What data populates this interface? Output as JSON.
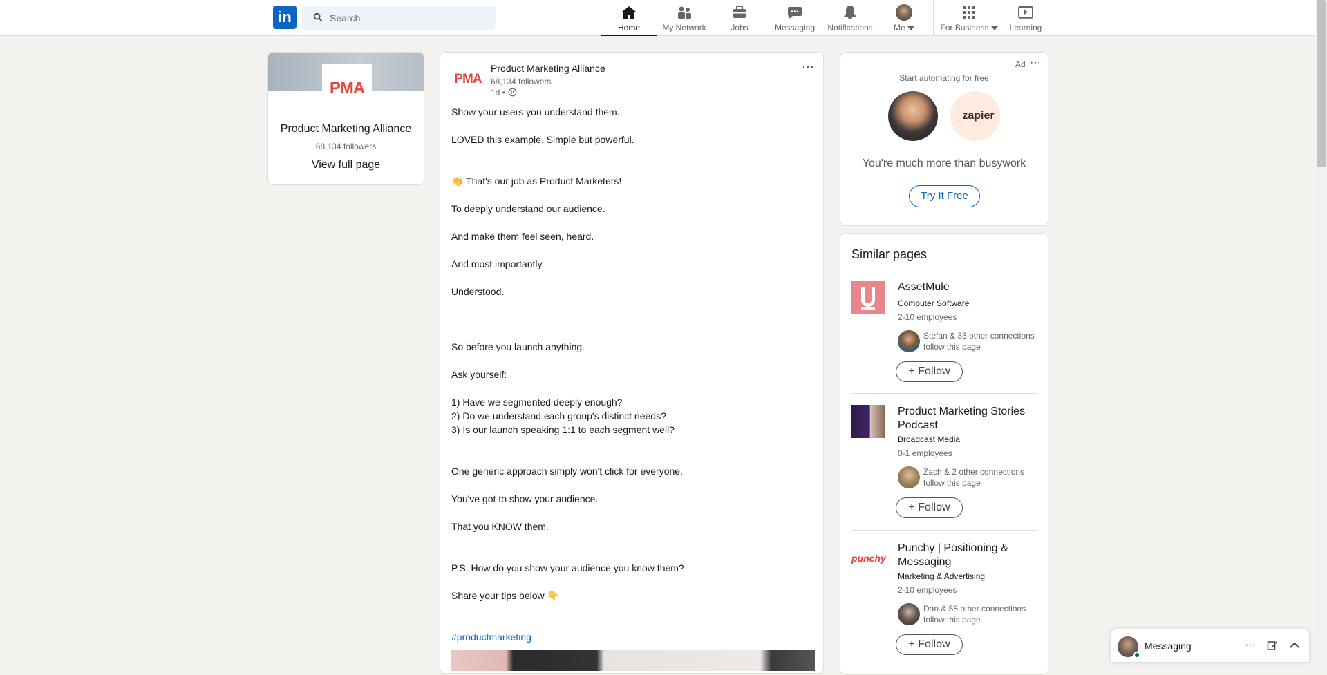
{
  "nav": {
    "search_placeholder": "Search",
    "items": [
      {
        "label": "Home"
      },
      {
        "label": "My Network"
      },
      {
        "label": "Jobs"
      },
      {
        "label": "Messaging"
      },
      {
        "label": "Notifications"
      },
      {
        "label": "Me"
      },
      {
        "label": "For Business"
      },
      {
        "label": "Learning"
      }
    ]
  },
  "company_card": {
    "logo_text": "PMA",
    "name": "Product Marketing Alliance",
    "followers": "68,134 followers",
    "view_link": "View full page"
  },
  "post": {
    "author": "Product Marketing Alliance",
    "followers": "68,134 followers",
    "time": "1d •",
    "more": "···",
    "lines": [
      "Show your users you understand them.",
      "LOVED this example. Simple but powerful.",
      "👏 That's our job as Product Marketers!",
      "To deeply understand our audience.",
      "And make them feel seen, heard.",
      "And most importantly.",
      "Understood.",
      "So before you launch anything.",
      "Ask yourself:",
      "1) Have we segmented deeply enough?",
      "2) Do we understand each group's distinct needs?",
      "3) Is our launch speaking 1:1 to each segment well?",
      "One generic approach simply won't click for everyone.",
      "You've got to show your audience.",
      "That you KNOW them.",
      "P.S. How do you show your audience you know them?",
      "Share your tips below 👇"
    ],
    "hashtag": "#productmarketing"
  },
  "ad": {
    "label": "Ad",
    "more": "···",
    "tagline": "Start automating for free",
    "brand": "zapier",
    "headline": "You're much more than busywork",
    "cta": "Try It Free"
  },
  "similar": {
    "title": "Similar pages",
    "items": [
      {
        "name": "AssetMule",
        "industry": "Computer Software",
        "employees": "2-10 employees",
        "connections": "Stefan & 33 other connections follow this page",
        "follow": "Follow"
      },
      {
        "name": "Product Marketing Stories Podcast",
        "industry": "Broadcast Media",
        "employees": "0-1 employees",
        "connections": "Zach & 2 other connections follow this page",
        "follow": "Follow"
      },
      {
        "name": "Punchy | Positioning & Messaging",
        "industry": "Marketing & Advertising",
        "employees": "2-10 employees",
        "connections": "Dan & 58 other connections follow this page",
        "follow": "Follow",
        "logo_text": "punchy"
      }
    ]
  },
  "messaging": {
    "label": "Messaging",
    "more": "···"
  },
  "colors": {
    "brand": "#0a66c2",
    "page_bg": "#f4f2ee",
    "pma_red": "#e34a3c",
    "online": "#057642"
  }
}
